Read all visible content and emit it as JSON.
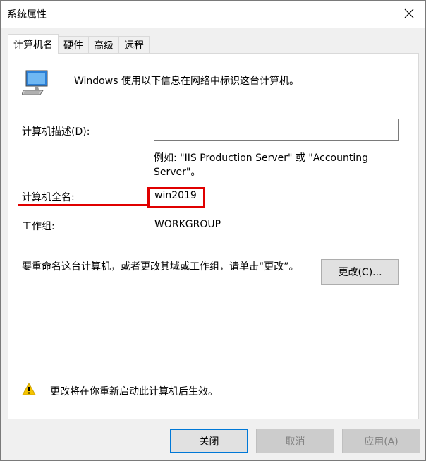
{
  "window": {
    "title": "系统属性",
    "close_glyph": "✕"
  },
  "tabs": [
    {
      "label": "计算机名",
      "active": true
    },
    {
      "label": "硬件",
      "active": false
    },
    {
      "label": "高级",
      "active": false
    },
    {
      "label": "远程",
      "active": false
    }
  ],
  "main": {
    "computer_icon": "computer-monitor-icon",
    "intro_text": "Windows 使用以下信息在网络中标识这台计算机。",
    "description": {
      "label": "计算机描述(D):",
      "value": "",
      "example": "例如: \"IIS Production Server\" 或 \"Accounting Server\"。"
    },
    "full_name": {
      "label": "计算机全名:",
      "value": "win2019"
    },
    "workgroup": {
      "label": "工作组:",
      "value": "WORKGROUP"
    },
    "rename": {
      "text": "要重命名这台计算机，或者更改其域或工作组，请单击“更改”。",
      "button_label": "更改(C)..."
    },
    "warning": {
      "icon": "warning-icon",
      "text": "更改将在你重新启动此计算机后生效。"
    }
  },
  "footer": {
    "close_label": "关闭",
    "cancel_label": "取消",
    "apply_label": "应用(A)"
  },
  "annotation_color": "#e00000"
}
